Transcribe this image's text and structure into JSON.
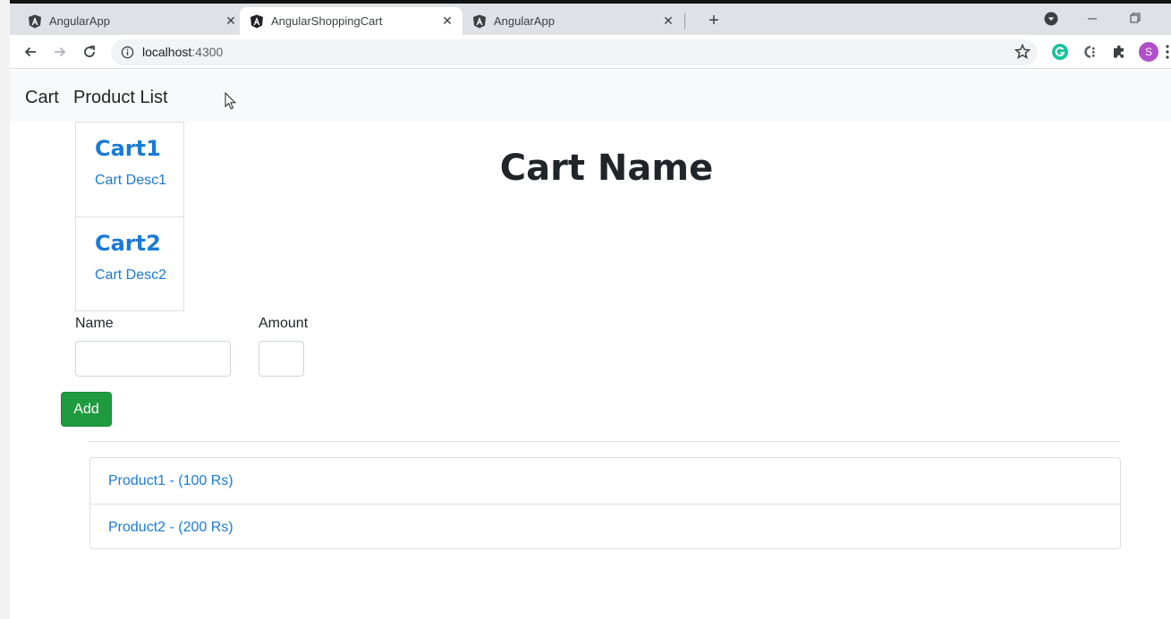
{
  "browser": {
    "tabs": [
      {
        "title": "AngularApp",
        "active": false
      },
      {
        "title": "AngularShoppingCart",
        "active": true
      },
      {
        "title": "AngularApp",
        "active": false
      }
    ],
    "url_host": "localhost",
    "url_port": ":4300",
    "avatar_letter": "S"
  },
  "nav": {
    "cart_link": "Cart",
    "product_list_link": "Product List"
  },
  "carts": [
    {
      "name": "Cart1",
      "description": "Cart Desc1"
    },
    {
      "name": "Cart2",
      "description": "Cart Desc2"
    }
  ],
  "page_title": "Cart Name",
  "form": {
    "name_label": "Name",
    "name_value": "",
    "amount_label": "Amount",
    "amount_value": "",
    "add_button": "Add"
  },
  "products": [
    {
      "label": "Product1 - (100 Rs)"
    },
    {
      "label": "Product2 - (200 Rs)"
    }
  ],
  "colors": {
    "link_blue": "#1a7ad6",
    "add_green": "#1e9b3f",
    "nav_bg": "#f8f9fa"
  }
}
